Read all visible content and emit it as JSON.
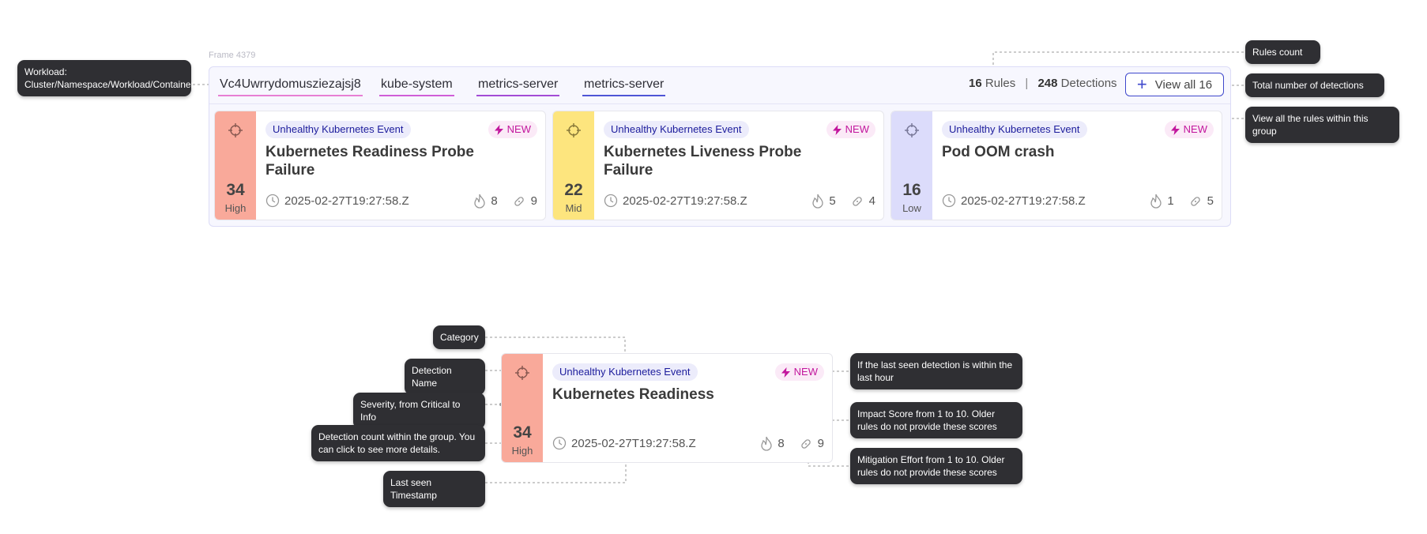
{
  "frame_label": "Frame 4379",
  "workload_tags": [
    "Vc4Uwrrydomusziezajsj8",
    "kube-system",
    "metrics-server",
    "metrics-server"
  ],
  "summary": {
    "rules_count": "16",
    "rules_label": "Rules",
    "separator": "|",
    "detections_count": "248",
    "detections_label": "Detections",
    "view_all_label": "View all 16"
  },
  "cards": [
    {
      "category": "Unhealthy Kubernetes Event",
      "new_label": "NEW",
      "title": "Kubernetes Readiness Probe Failure",
      "count": "34",
      "severity": "High",
      "severity_color": "#f9a99a",
      "timestamp": "2025-02-27T19:27:58.Z",
      "impact": "8",
      "effort": "9"
    },
    {
      "category": "Unhealthy Kubernetes Event",
      "new_label": "NEW",
      "title": "Kubernetes Liveness Probe Failure",
      "count": "22",
      "severity": "Mid",
      "severity_color": "#fde57e",
      "timestamp": "2025-02-27T19:27:58.Z",
      "impact": "5",
      "effort": "4"
    },
    {
      "category": "Unhealthy Kubernetes Event",
      "new_label": "NEW",
      "title": "Pod OOM crash",
      "count": "16",
      "severity": "Low",
      "severity_color": "#dcdcfb",
      "timestamp": "2025-02-27T19:27:58.Z",
      "impact": "1",
      "effort": "5"
    }
  ],
  "anatomy_card": {
    "category": "Unhealthy Kubernetes Event",
    "new_label": "NEW",
    "title": "Kubernetes Readiness",
    "count": "34",
    "severity": "High",
    "severity_color": "#f9a99a",
    "timestamp": "2025-02-27T19:27:58.Z",
    "impact": "8",
    "effort": "9"
  },
  "annotations": {
    "workload": "Workload: Cluster/Namespace/Workload/Container",
    "rules_count": "Rules count",
    "total_detections": "Total number of detections",
    "view_all": "View all the rules within this group",
    "category": "Category",
    "detection_name": "Detection Name",
    "severity": "Severity, from Critical to Info",
    "detection_count": "Detection count within the group. You can click to see more details.",
    "last_seen": "Last seen Timestamp",
    "new_badge": "If the last seen detection is within the last hour",
    "impact_score": "Impact Score from 1 to 10. Older rules do not provide these scores",
    "mitigation_effort": "Mitigation Effort from 1 to 10. Older rules do not provide these scores"
  },
  "colors": {
    "accent": "#3f48cc",
    "high": "#f9a99a",
    "mid": "#fde57e",
    "low": "#dcdcfb",
    "new_badge": "#c2179d",
    "tag_underlines": [
      "#e77fd4",
      "#d05ed8",
      "#a34cd6",
      "#4f55d6"
    ]
  },
  "icons": {
    "severity": "crosshair-icon",
    "timestamp": "clock-icon",
    "impact": "flame-icon",
    "effort": "bandage-icon",
    "new": "lightning-icon",
    "view_all": "plus-icon"
  }
}
